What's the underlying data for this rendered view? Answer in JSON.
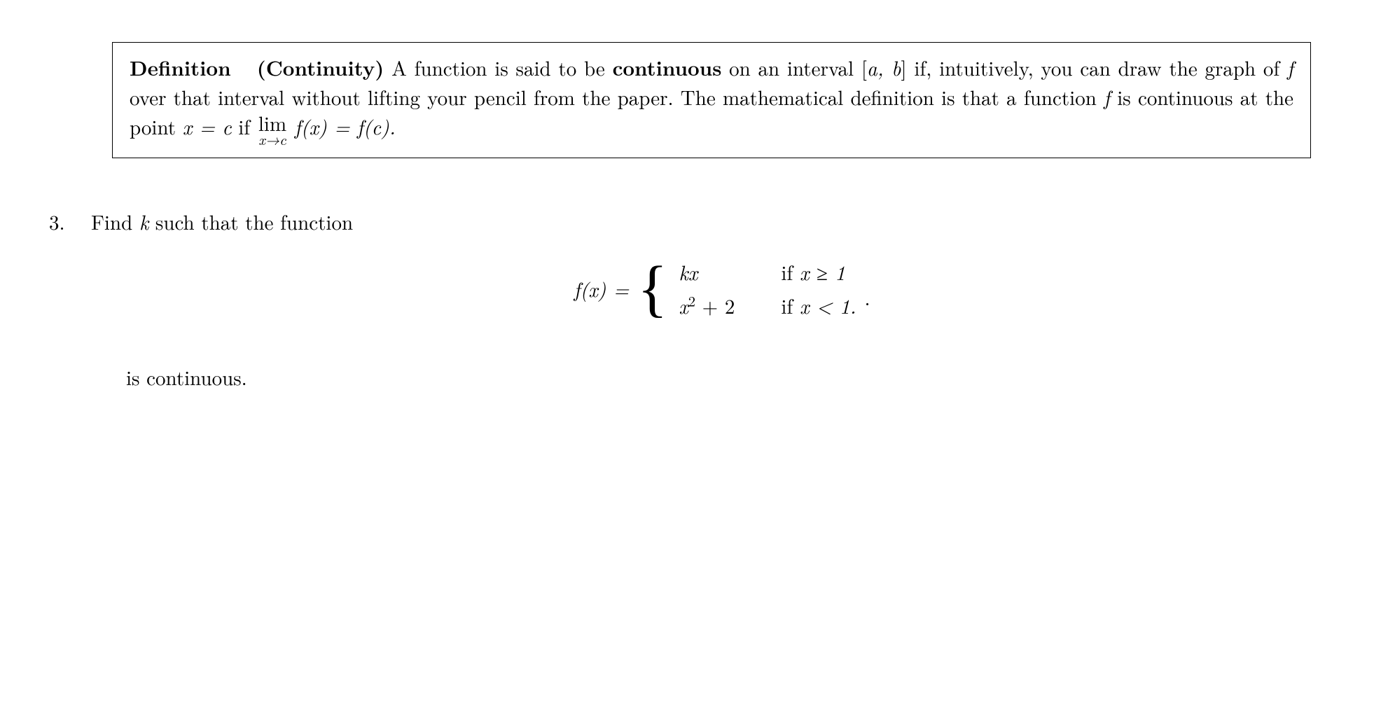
{
  "definition": {
    "label_bold1": "Definition",
    "label_bold2": "(Continuity)",
    "text_part1": " A function is said to be ",
    "continuous_bold": "continuous",
    "text_part2": " on an interval ",
    "interval": "[a, b]",
    "text_part3": " if, intuitively, you can draw the graph of ",
    "f_1": "f",
    "text_part4": " over that interval without lifting your pencil from the paper.  The mathematical definition is that a function ",
    "f_2": "f",
    "text_part5": " is continuous at the point ",
    "xeqc": "x = c",
    "text_if": " if ",
    "lim_top": "lim",
    "lim_bot": "x→c",
    "fx_eq_fc": " f(x) = f(c)."
  },
  "problem": {
    "number": "3.",
    "intro_part1": "Find ",
    "k": "k",
    "intro_part2": " such that the function",
    "fx_label": "f(x) = ",
    "case1_expr": "kx",
    "case1_cond_if": "if ",
    "case1_cond_math": "x ≥ 1",
    "case2_expr_x": "x",
    "case2_expr_sup": "2",
    "case2_expr_rest": " + 2",
    "case2_cond_if": "if ",
    "case2_cond_math": "x < 1.",
    "trailing_period": ".",
    "closing": "is continuous."
  }
}
